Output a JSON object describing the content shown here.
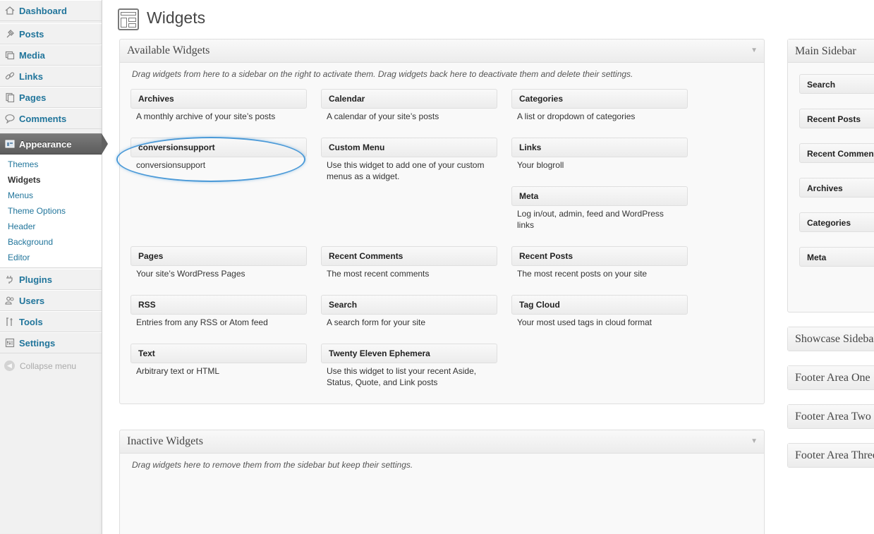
{
  "menu": {
    "items": [
      {
        "label": "Dashboard",
        "icon": "dashboard-icon"
      },
      {
        "label": "Posts",
        "icon": "pushpin-icon"
      },
      {
        "label": "Media",
        "icon": "media-icon"
      },
      {
        "label": "Links",
        "icon": "link-icon"
      },
      {
        "label": "Pages",
        "icon": "pages-icon"
      },
      {
        "label": "Comments",
        "icon": "comment-icon"
      },
      {
        "label": "Appearance",
        "icon": "appearance-icon"
      },
      {
        "label": "Plugins",
        "icon": "plug-icon"
      },
      {
        "label": "Users",
        "icon": "users-icon"
      },
      {
        "label": "Tools",
        "icon": "tools-icon"
      },
      {
        "label": "Settings",
        "icon": "settings-icon"
      }
    ],
    "submenu": [
      "Themes",
      "Widgets",
      "Menus",
      "Theme Options",
      "Header",
      "Background",
      "Editor"
    ],
    "collapse_label": "Collapse menu"
  },
  "page": {
    "title": "Widgets"
  },
  "available": {
    "title": "Available Widgets",
    "description": "Drag widgets from here to a sidebar on the right to activate them. Drag widgets back here to deactivate them and delete their settings.",
    "widgets": [
      {
        "name": "Archives",
        "desc": "A monthly archive of your site’s posts"
      },
      {
        "name": "Calendar",
        "desc": "A calendar of your site’s posts"
      },
      {
        "name": "Categories",
        "desc": "A list or dropdown of categories"
      },
      {
        "name": "conversionsupport",
        "desc": "conversionsupport"
      },
      {
        "name": "Custom Menu",
        "desc": "Use this widget to add one of your custom menus as a widget."
      },
      {
        "name": "Links",
        "desc": "Your blogroll"
      },
      {
        "name": "Meta",
        "desc": "Log in/out, admin, feed and WordPress links"
      },
      {
        "name": "Pages",
        "desc": "Your site’s WordPress Pages"
      },
      {
        "name": "Recent Comments",
        "desc": "The most recent comments"
      },
      {
        "name": "Recent Posts",
        "desc": "The most recent posts on your site"
      },
      {
        "name": "RSS",
        "desc": "Entries from any RSS or Atom feed"
      },
      {
        "name": "Search",
        "desc": "A search form for your site"
      },
      {
        "name": "Tag Cloud",
        "desc": "Your most used tags in cloud format"
      },
      {
        "name": "Text",
        "desc": "Arbitrary text or HTML"
      },
      {
        "name": "Twenty Eleven Ephemera",
        "desc": "Use this widget to list your recent Aside, Status, Quote, and Link posts"
      }
    ]
  },
  "inactive": {
    "title": "Inactive Widgets",
    "description": "Drag widgets here to remove them from the sidebar but keep their settings."
  },
  "sidebars": {
    "main": {
      "title": "Main Sidebar",
      "widgets": [
        "Search",
        "Recent Posts",
        "Recent Comments",
        "Archives",
        "Categories",
        "Meta"
      ]
    },
    "others": [
      "Showcase Sidebar",
      "Footer Area One",
      "Footer Area Two",
      "Footer Area Three"
    ]
  },
  "colors": {
    "link": "#21759b",
    "highlight": "#4b9ad8",
    "current_menu": "#6d6d6d"
  }
}
